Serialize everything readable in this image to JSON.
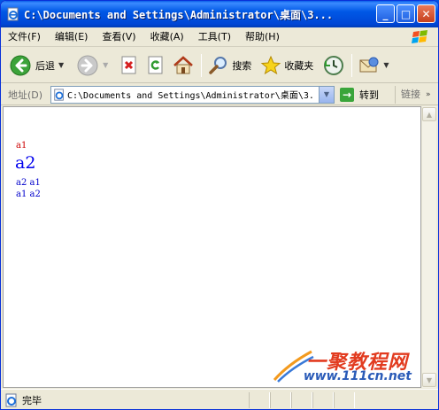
{
  "window": {
    "title": "C:\\Documents and Settings\\Administrator\\桌面\\3...",
    "minimize_glyph": "_",
    "maximize_glyph": "□",
    "close_glyph": "✕"
  },
  "menu": [
    "文件(F)",
    "编辑(E)",
    "查看(V)",
    "收藏(A)",
    "工具(T)",
    "帮助(H)"
  ],
  "toolbar": {
    "back_label": "后退",
    "search_label": "搜索",
    "favorites_label": "收藏夹"
  },
  "address": {
    "label": "地址(D)",
    "value": "C:\\Documents and Settings\\Administrator\\桌面\\3.",
    "go_label": "转到",
    "links_label": "链接"
  },
  "page": {
    "line1": "a1",
    "line2": "a2",
    "line3": "a2 a1",
    "line4": "a1 a2",
    "colors": {
      "line1": "#cc0000",
      "line2": "#0000ee",
      "line3": "#0000cc",
      "line4": "#0000cc"
    }
  },
  "watermark": {
    "logo": "一聚教程网",
    "url": "www.111cn.net"
  },
  "status": {
    "text": "完毕"
  }
}
